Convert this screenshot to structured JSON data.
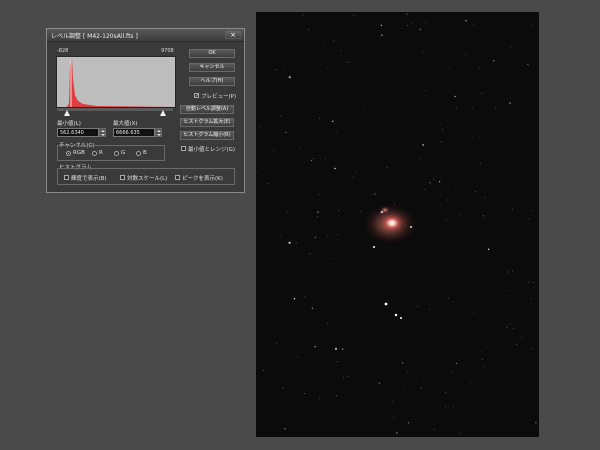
{
  "dialog": {
    "title": "レベル調整 [ M42-120sAll.fts ]",
    "close_glyph": "×",
    "histogram_range": {
      "min": "-828",
      "max": "9708"
    },
    "min_level": {
      "label": "最小値(L)",
      "value": "562.6340"
    },
    "max_level": {
      "label": "最大値(X)",
      "value": "6666.635"
    },
    "buttons": {
      "ok": "OK",
      "cancel": "キャンセル",
      "help": "ヘルプ(H)",
      "auto_level": "自動レベル調整(A)",
      "hist_enlarge": "ヒストグラム拡大(E)",
      "hist_reduce": "ヒストグラム縮小(R)"
    },
    "preview": {
      "label": "プレビュー(P)",
      "checked": true
    },
    "min_max_range": {
      "label": "最小値とレンジ(G)",
      "checked": false
    },
    "channel": {
      "label": "チャンネル(C)",
      "options": [
        "RGB",
        "R",
        "G",
        "B"
      ],
      "selected": "RGB"
    },
    "histogram_group": {
      "label": "ヒストグラム",
      "options": [
        {
          "label": "輝度で表示(B)",
          "checked": false
        },
        {
          "label": "対数スケール(L)",
          "checked": false
        },
        {
          "label": "ピークを表示(K)",
          "checked": false
        }
      ]
    }
  },
  "colors": {
    "workspace": "#4a4a4a",
    "dialog_bg": "#3a3a3a",
    "histogram_bg": "#bdbdbd",
    "histogram_curve": "#e03030",
    "photo_bg": "#0c0b0b",
    "nebula": "#ffb0a0"
  },
  "icons": [
    "close-icon",
    "spin-up-icon",
    "spin-down-icon",
    "slider-triangle-icon"
  ]
}
